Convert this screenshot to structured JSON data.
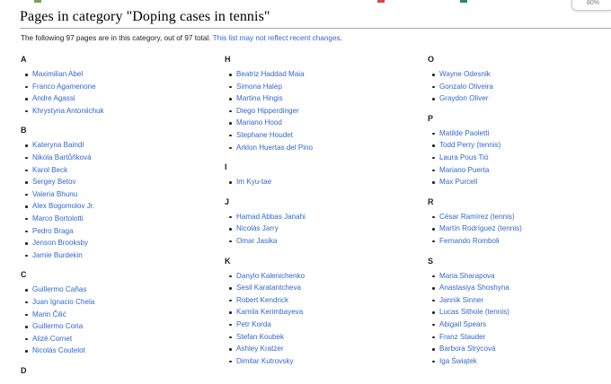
{
  "browser": {
    "zoom_label": "80%"
  },
  "page": {
    "title": "Pages in category \"Doping cases in tennis\"",
    "intro_text": "The following 97 pages are in this category, out of 97 total.",
    "intro_link": "This list may not reflect recent changes",
    "intro_end": "."
  },
  "columns": [
    [
      {
        "letter": "A",
        "items": [
          "Maximilian Abel",
          "Franco Agamenone",
          "Andre Agassi",
          "Khrystyna Antoniichuk"
        ]
      },
      {
        "letter": "B",
        "items": [
          "Kateryna Baindl",
          "Nikola Bartůňková",
          "Karol Beck",
          "Sergey Betov",
          "Valeria Bhunu",
          "Alex Bogomolov Jr.",
          "Marco Bortolotti",
          "Pedro Braga",
          "Jenson Brooksby",
          "Jamie Burdekin"
        ]
      },
      {
        "letter": "C",
        "items": [
          "Guillermo Cañas",
          "Juan Ignacio Chela",
          "Marin Čilić",
          "Guillermo Coria",
          "Alizé Cornet",
          "Nicolás Coutelot"
        ]
      },
      {
        "letter": "D",
        "items": []
      }
    ],
    [
      {
        "letter": "H",
        "items": [
          "Beatriz Haddad Maia",
          "Simona Halep",
          "Martina Hingis",
          "Diego Hipperdinger",
          "Mariano Hood",
          "Stephane Houdet",
          "Arklon Huertas del Pino"
        ]
      },
      {
        "letter": "I",
        "items": [
          "Im Kyu-tae"
        ]
      },
      {
        "letter": "J",
        "items": [
          "Hamad Abbas Janahi",
          "Nicolás Jarry",
          "Omar Jasika"
        ]
      },
      {
        "letter": "K",
        "items": [
          "Danylo Kalenichenko",
          "Sesil Karatantcheva",
          "Robert Kendrick",
          "Kamila Kerimbayeva",
          "Petr Korda",
          "Stefan Koubek",
          "Ashley Kratzer",
          "Dimitar Kutrovsky"
        ]
      }
    ],
    [
      {
        "letter": "O",
        "items": [
          "Wayne Odesnik",
          "Gonzalo Oliveira",
          "Graydon Oliver"
        ]
      },
      {
        "letter": "P",
        "items": [
          "Matilde Paoletti",
          "Todd Perry (tennis)",
          "Laura Pous Tió",
          "Mariano Puerta",
          "Max Purcell"
        ]
      },
      {
        "letter": "R",
        "items": [
          "César Ramírez (tennis)",
          "Martín Rodríguez (tennis)",
          "Fernando Romboli"
        ]
      },
      {
        "letter": "S",
        "items": [
          "Maria Sharapova",
          "Anastasiya Shoshyna",
          "Jannik Sinner",
          "Lucas Sithole (tennis)",
          "Abigail Spears",
          "Franz Stauder",
          "Barbora Strýcová",
          "Iga Świątek"
        ]
      }
    ]
  ]
}
